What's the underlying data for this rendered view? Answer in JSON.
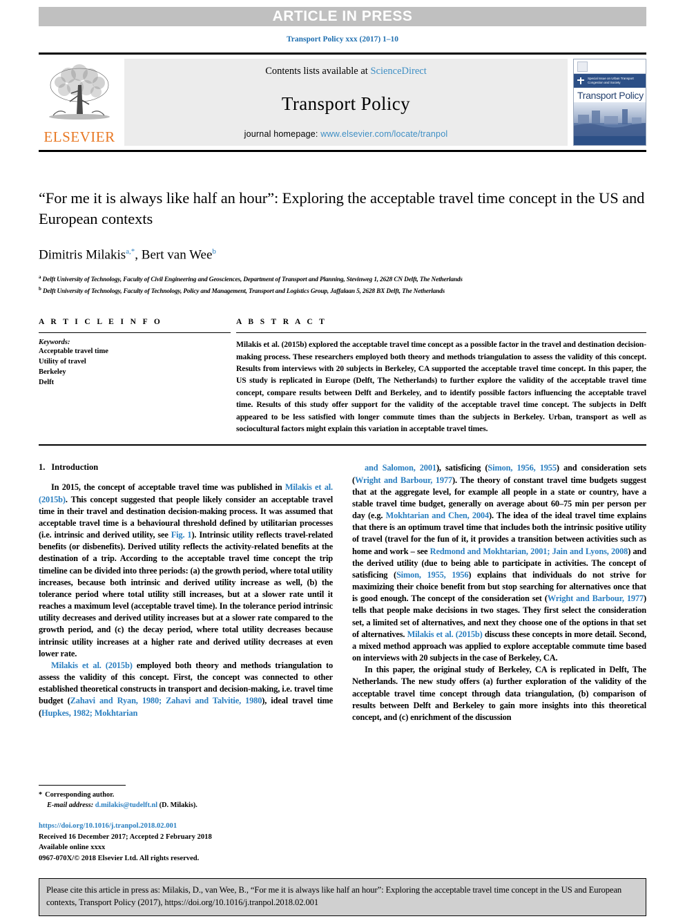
{
  "banner": {
    "text": "ARTICLE IN PRESS"
  },
  "running_head": {
    "text": "Transport Policy xxx (2017) 1–10"
  },
  "masthead": {
    "publisher_wordmark": "ELSEVIER",
    "contents_prefix": "Contents lists available at ",
    "contents_link": "ScienceDirect",
    "journal_name": "Transport Policy",
    "homepage_prefix": "journal homepage: ",
    "homepage_link": "www.elsevier.com/locate/tranpol",
    "cover": {
      "badge_line1": "Special Issue on Urban Transport",
      "badge_line2": "Congestion and Society",
      "title": "Transport Policy"
    },
    "accent_color": "#3d8ec4",
    "elsevier_orange": "#e87722"
  },
  "title": {
    "text": "“For me it is always like half an hour”: Exploring the acceptable travel time concept in the US and European contexts"
  },
  "authors": {
    "author1_name": "Dimitris Milakis",
    "author1_marks": "a,*",
    "separator": ", ",
    "author2_name": "Bert van Wee",
    "author2_marks": "b"
  },
  "affiliations": [
    {
      "mark": "a",
      "text": "Delft University of Technology, Faculty of Civil Engineering and Geosciences, Department of Transport and Planning, Stevinweg 1, 2628 CN Delft, The Netherlands"
    },
    {
      "mark": "b",
      "text": "Delft University of Technology, Faculty of Technology, Policy and Management, Transport and Logistics Group, Jaffalaan 5, 2628 BX Delft, The Netherlands"
    }
  ],
  "article_info": {
    "label": "A R T I C L E  I N F O",
    "keywords_label": "Keywords:",
    "keywords": [
      "Acceptable travel time",
      "Utility of travel",
      "Berkeley",
      "Delft"
    ]
  },
  "abstract": {
    "label": "A B S T R A C T",
    "text": "Milakis et al. (2015b) explored the acceptable travel time concept as a possible factor in the travel and destination decision-making process. These researchers employed both theory and methods triangulation to assess the validity of this concept. Results from interviews with 20 subjects in Berkeley, CA supported the acceptable travel time concept. In this paper, the US study is replicated in Europe (Delft, The Netherlands) to further explore the validity of the acceptable travel time concept, compare results between Delft and Berkeley, and to identify possible factors influencing the acceptable travel time. Results of this study offer support for the validity of the acceptable travel time concept. The subjects in Delft appeared to be less satisfied with longer commute times than the subjects in Berkeley. Urban, transport as well as sociocultural factors might explain this variation in acceptable travel times."
  },
  "section": {
    "number": "1.",
    "title": "Introduction"
  },
  "body": {
    "left_paragraphs": [
      {
        "runs": [
          {
            "t": "In 2015, the concept of acceptable travel time was published in ",
            "ref": false
          },
          {
            "t": "Milakis et al. (2015b)",
            "ref": true
          },
          {
            "t": ". This concept suggested that people likely consider an acceptable travel time in their travel and destination decision-making process. It was assumed that acceptable travel time is a behavioural threshold defined by utilitarian processes (i.e. intrinsic and derived utility, see ",
            "ref": false
          },
          {
            "t": "Fig. 1",
            "ref": true
          },
          {
            "t": "). Intrinsic utility reflects travel-related benefits (or disbenefits). Derived utility reflects the activity-related benefits at the destination of a trip. According to the acceptable travel time concept the trip timeline can be divided into three periods: (a) the growth period, where total utility increases, because both intrinsic and derived utility increase as well, (b) the tolerance period where total utility still increases, but at a slower rate until it reaches a maximum level (acceptable travel time). In the tolerance period intrinsic utility decreases and derived utility increases but at a slower rate compared to the growth period, and (c) the decay period, where total utility decreases because intrinsic utility increases at a higher rate and derived utility decreases at even lower rate.",
            "ref": false
          }
        ]
      },
      {
        "runs": [
          {
            "t": "Milakis et al. (2015b)",
            "ref": true
          },
          {
            "t": " employed both theory and methods triangulation to assess the validity of this concept. First, the concept was connected to other established theoretical constructs in transport and decision-making, i.e. travel time budget (",
            "ref": false
          },
          {
            "t": "Zahavi and Ryan, 1980; Zahavi and Talvitie, 1980",
            "ref": true
          },
          {
            "t": "), ideal travel time (",
            "ref": false
          },
          {
            "t": "Hupkes, 1982; Mokhtarian",
            "ref": true
          }
        ]
      }
    ],
    "right_paragraphs": [
      {
        "runs": [
          {
            "t": "and Salomon, 2001",
            "ref": true
          },
          {
            "t": "), satisficing (",
            "ref": false
          },
          {
            "t": "Simon, 1956, 1955",
            "ref": true
          },
          {
            "t": ") and consideration sets (",
            "ref": false
          },
          {
            "t": "Wright and Barbour, 1977",
            "ref": true
          },
          {
            "t": "). The theory of constant travel time budgets suggest that at the aggregate level, for example all people in a state or country, have a stable travel time budget, generally on average about 60–75 min per person per day (e.g. ",
            "ref": false
          },
          {
            "t": "Mokhtarian and Chen, 2004",
            "ref": true
          },
          {
            "t": "). The idea of the ideal travel time explains that there is an optimum travel time that includes both the intrinsic positive utility of travel (travel for the fun of it, it provides a transition between activities such as home and work – see ",
            "ref": false
          },
          {
            "t": "Redmond and Mokhtarian, 2001; Jain and Lyons, 2008",
            "ref": true
          },
          {
            "t": ") and the derived utility (due to being able to participate in activities. The concept of satisficing (",
            "ref": false
          },
          {
            "t": "Simon, 1955, 1956",
            "ref": true
          },
          {
            "t": ") explains that individuals do not strive for maximizing their choice benefit from but stop searching for alternatives once that is good enough. The concept of the consideration set (",
            "ref": false
          },
          {
            "t": "Wright and Barbour, 1977",
            "ref": true
          },
          {
            "t": ") tells that people make decisions in two stages. They first select the consideration set, a limited set of alternatives, and next they choose one of the options in that set of alternatives. ",
            "ref": false
          },
          {
            "t": "Milakis et al. (2015b)",
            "ref": true
          },
          {
            "t": " discuss these concepts in more detail. Second, a mixed method approach was applied to explore acceptable commute time based on interviews with 20 subjects in the case of Berkeley, CA.",
            "ref": false
          }
        ]
      },
      {
        "runs": [
          {
            "t": "In this paper, the original study of Berkeley, CA is replicated in Delft, The Netherlands. The new study offers (a) further exploration of the validity of the acceptable travel time concept through data triangulation, (b) comparison of results between Delft and Berkeley to gain more insights into this theoretical concept, and (c) enrichment of the discussion",
            "ref": false
          }
        ]
      }
    ]
  },
  "footnotes": {
    "corresponding_star": "*",
    "corresponding_text": "Corresponding author.",
    "email_label": "E-mail address:",
    "email_link": "d.milakis@tudelft.nl",
    "email_suffix": " (D. Milakis).",
    "doi": "https://doi.org/10.1016/j.tranpol.2018.02.001",
    "received": "Received 16 December 2017; Accepted 2 February 2018",
    "available": "Available online xxxx",
    "copyright": "0967-070X/© 2018 Elsevier Ltd. All rights reserved."
  },
  "citation_box": {
    "text": "Please cite this article in press as: Milakis, D., van Wee, B., “For me it is always like half an hour”: Exploring the acceptable travel time concept in the US and European contexts, Transport Policy (2017), https://doi.org/10.1016/j.tranpol.2018.02.001"
  }
}
